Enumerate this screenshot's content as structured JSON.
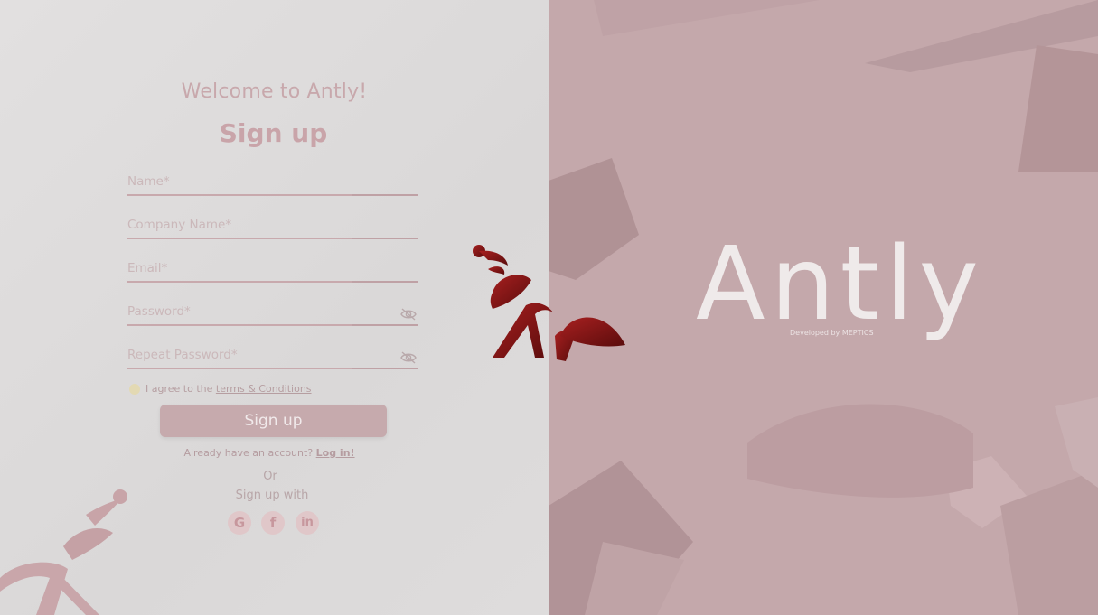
{
  "form": {
    "welcome": "Welcome to Antly!",
    "title": "Sign up",
    "fields": [
      {
        "placeholder": "Name*"
      },
      {
        "placeholder": "Company Name*"
      },
      {
        "placeholder": "Email*"
      },
      {
        "placeholder": "Password*"
      },
      {
        "placeholder": "Repeat Password*"
      }
    ],
    "agree_prefix": "I agree to the",
    "agree_link": "terms & Conditions",
    "submit_label": "Sign up",
    "already_text": "Already have an account?",
    "login_link": "Log in!",
    "or_text": "Or",
    "signup_with": "Sign up with",
    "social": {
      "google": "G",
      "facebook": "f",
      "linkedin": "in"
    }
  },
  "brand": {
    "name": "Antly",
    "developed_by": "Developed by MEPTICS"
  },
  "icons": {
    "password_visibility": "eye-off-icon",
    "logo": "ant-logo-icon"
  },
  "colors": {
    "accent": "#8b1a1a",
    "right_panel": "#c4a8ab",
    "left_panel": "#dedcdc"
  }
}
